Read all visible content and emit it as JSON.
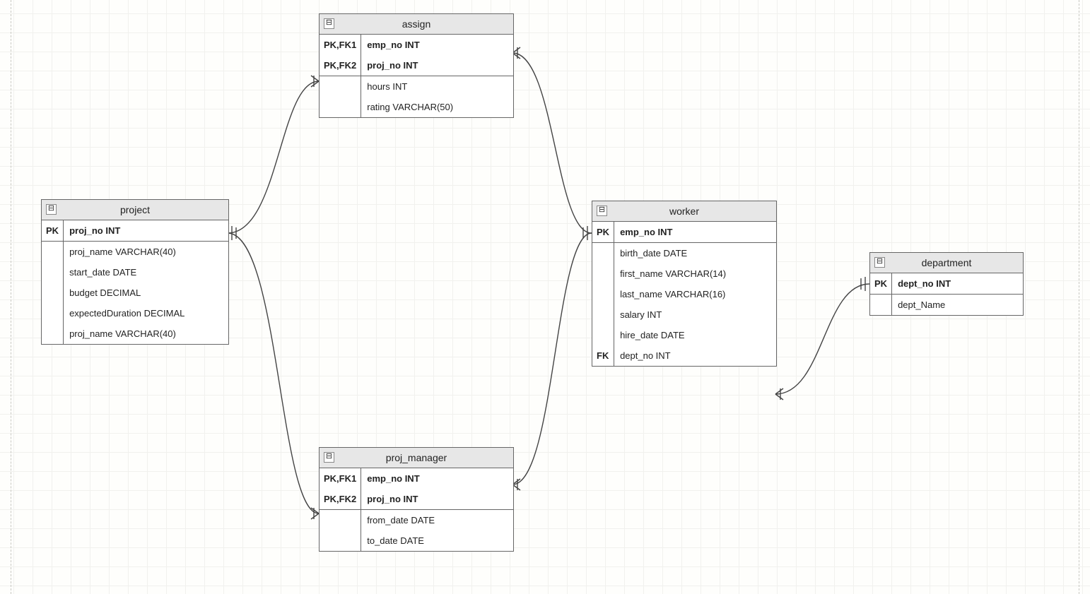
{
  "entities": {
    "project": {
      "title": "project",
      "rows": [
        {
          "key": "PK",
          "field": "proj_no  INT",
          "pk": true,
          "sep": false
        },
        {
          "key": "",
          "field": "proj_name  VARCHAR(40)",
          "pk": false,
          "sep": true
        },
        {
          "key": "",
          "field": "start_date  DATE",
          "pk": false,
          "sep": false
        },
        {
          "key": "",
          "field": "budget   DECIMAL",
          "pk": false,
          "sep": false
        },
        {
          "key": "",
          "field": "expectedDuration  DECIMAL",
          "pk": false,
          "sep": false
        },
        {
          "key": "",
          "field": "proj_name  VARCHAR(40)",
          "pk": false,
          "sep": false
        }
      ]
    },
    "assign": {
      "title": "assign",
      "rows": [
        {
          "key": "PK,FK1",
          "field": "emp_no  INT",
          "pk": true,
          "sep": false
        },
        {
          "key": "PK,FK2",
          "field": "proj_no  INT",
          "pk": true,
          "sep": false
        },
        {
          "key": "",
          "field": "hours  INT",
          "pk": false,
          "sep": true
        },
        {
          "key": "",
          "field": "rating  VARCHAR(50)",
          "pk": false,
          "sep": false
        }
      ]
    },
    "worker": {
      "title": "worker",
      "rows": [
        {
          "key": "PK",
          "field": "emp_no  INT",
          "pk": true,
          "sep": false
        },
        {
          "key": "",
          "field": "birth_date  DATE",
          "pk": false,
          "sep": true
        },
        {
          "key": "",
          "field": "first_name  VARCHAR(14)",
          "pk": false,
          "sep": false
        },
        {
          "key": "",
          "field": "last_name  VARCHAR(16)",
          "pk": false,
          "sep": false
        },
        {
          "key": "",
          "field": "salary  INT",
          "pk": false,
          "sep": false
        },
        {
          "key": "",
          "field": "hire_date  DATE",
          "pk": false,
          "sep": false
        },
        {
          "key": "FK",
          "field": "dept_no  INT",
          "pk": false,
          "sep": false
        }
      ]
    },
    "proj_manager": {
      "title": "proj_manager",
      "rows": [
        {
          "key": "PK,FK1",
          "field": "emp_no  INT",
          "pk": true,
          "sep": false
        },
        {
          "key": "PK,FK2",
          "field": "proj_no  INT",
          "pk": true,
          "sep": false
        },
        {
          "key": "",
          "field": "from_date  DATE",
          "pk": false,
          "sep": true
        },
        {
          "key": "",
          "field": "to_date  DATE",
          "pk": false,
          "sep": false
        }
      ]
    },
    "department": {
      "title": "department",
      "rows": [
        {
          "key": "PK",
          "field": "dept_no  INT",
          "pk": true,
          "sep": false
        },
        {
          "key": "",
          "field": "dept_Name",
          "pk": false,
          "sep": true
        }
      ]
    }
  },
  "collapse_glyph": "⊟"
}
